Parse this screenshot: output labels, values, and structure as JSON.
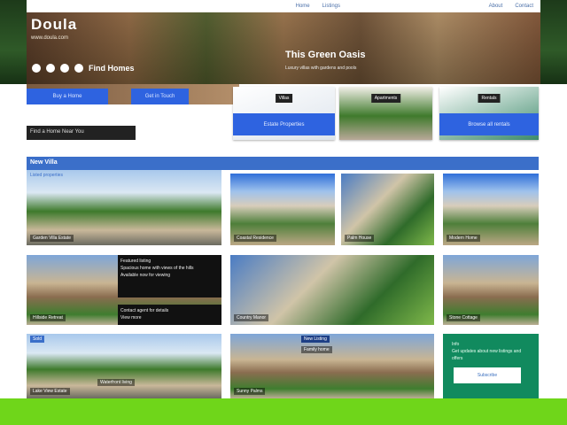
{
  "topbar": {
    "left_links": [
      "Home",
      "Listings"
    ],
    "right_links": [
      "About",
      "Contact"
    ]
  },
  "hero": {
    "logo": "Doula",
    "tagline": "www.doula.com",
    "icon_text": "Find Homes",
    "title": "This Green Oasis",
    "subtitle": "Luxury villas with gardens and pools"
  },
  "buttons": {
    "primary": "Buy a Home",
    "secondary": "Get in Touch"
  },
  "cards": [
    {
      "label": "Villas",
      "band": "Estate Properties"
    },
    {
      "label": "Apartments",
      "band": ""
    },
    {
      "label": "Rentals",
      "band": "Browse all rentals"
    }
  ],
  "dark_label": "Find a Home Near You",
  "section": {
    "title": "New Villa",
    "subtitle": "Listed properties"
  },
  "tiles": [
    {
      "caption": "Garden Villa Estate"
    },
    {
      "caption": "Coastal Residence"
    },
    {
      "caption": "Palm House"
    },
    {
      "caption": "Modern Home"
    },
    {
      "caption": "Hillside Retreat",
      "overlay": [
        "Featured listing",
        "Spacious home with views of the hills",
        "Available now for viewing",
        "Contact agent for details",
        "View more"
      ]
    },
    {
      "caption": "Country Manor"
    },
    {
      "caption": "Stone Cottage"
    },
    {
      "caption": "Lake View Estate",
      "badge": "Sold",
      "sub": "Waterfront living"
    },
    {
      "caption": "Sunny Palms",
      "badge": "New Listing",
      "sub": "Family home"
    }
  ],
  "promo": {
    "title": "Info",
    "text": "Get updates about new listings and offers",
    "button": "Subscribe"
  }
}
